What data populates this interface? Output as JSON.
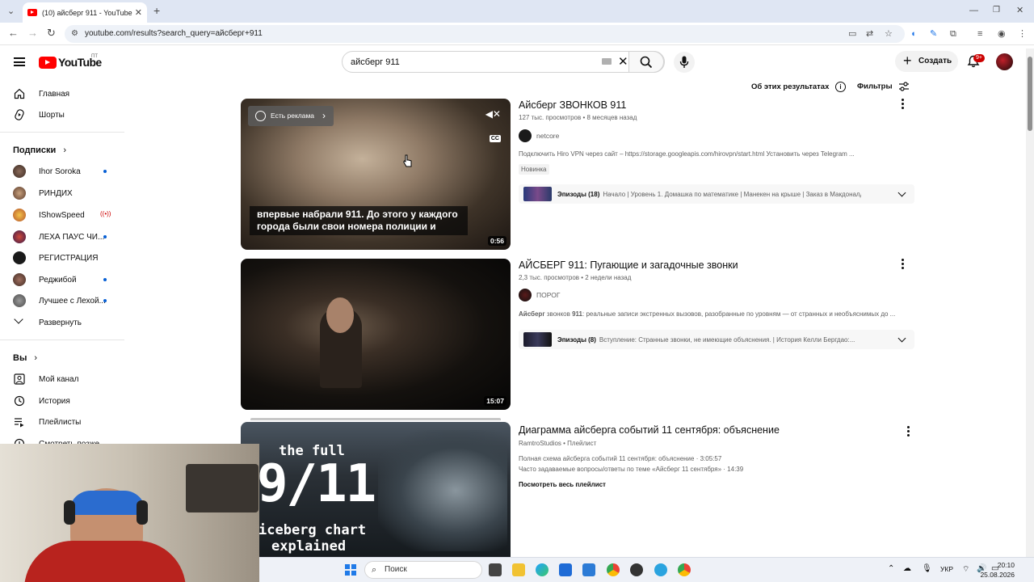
{
  "browser": {
    "tab_title": "(10) айсберг 911 - YouTube",
    "url": "youtube.com/results?search_query=айсберг+911"
  },
  "header": {
    "logo_text": "YouTube",
    "logo_country": "ПТ",
    "search_query": "айсберг 911",
    "create_label": "Создать",
    "notifications_badge": "9+"
  },
  "sidebar": {
    "main": [
      {
        "label": "Главная",
        "icon": "home-icon"
      },
      {
        "label": "Шорты",
        "icon": "shorts-icon"
      }
    ],
    "subscriptions_title": "Подписки",
    "subscriptions": [
      {
        "label": "Ihor Soroka",
        "indicator": "new"
      },
      {
        "label": "РИНДИХ",
        "indicator": ""
      },
      {
        "label": "IShowSpeed",
        "indicator": "live"
      },
      {
        "label": "ЛЕХА ПАУС ЧИ...",
        "indicator": "new"
      },
      {
        "label": "РЕГИСТРАЦИЯ",
        "indicator": ""
      },
      {
        "label": "Реджибой",
        "indicator": "new"
      },
      {
        "label": "Лучшее с Лехой...",
        "indicator": "new"
      }
    ],
    "expand_label": "Развернуть",
    "you_title": "Вы",
    "you_items": [
      {
        "label": "Мой канал",
        "icon": "my-channel-icon"
      },
      {
        "label": "История",
        "icon": "history-icon"
      },
      {
        "label": "Плейлисты",
        "icon": "playlists-icon"
      },
      {
        "label": "Смотреть позже",
        "icon": "watch-later-icon"
      }
    ]
  },
  "results_bar": {
    "about_label": "Об этих результатах",
    "filters_label": "Фильтры"
  },
  "results": [
    {
      "title": "Айсберг ЗВОНКОВ 911",
      "meta": "127 тыс. просмотров • 8 месяцев назад",
      "channel": "netcore",
      "description": "Подключить Hiro VPN через сайт – https://storage.googleapis.com/hirovpn/start.html Установить через Telegram ...",
      "badge": "Новинка",
      "episodes_label": "Эпизоды (18)",
      "episodes_text": "Начало | Уровень 1. Домашка по математике | Манекен на крыше | Заказ в Макдоналдс | ...",
      "duration": "0:56",
      "ad_label": "Есть реклама",
      "caption": "впервые набрали 911. До этого у каждого города были свои номера полиции и",
      "cc_label": "CC"
    },
    {
      "title": "АЙСБЕРГ 911: Пугающие и загадочные звонки",
      "meta": "2,3 тыс. просмотров • 2 недели назад",
      "channel": "ПОРОГ",
      "description_bold": "Айсберг",
      "description_mid": " звонков ",
      "description_bold2": "911",
      "description_rest": ": реальные записи экстренных вызовов, разобранные по уровням — от странных и необъяснимых до ...",
      "episodes_label": "Эпизоды (8)",
      "episodes_text": "Вступление: Странные звонки, не имеющие объяснения. | История Келли Бергдао:...",
      "duration": "15:07"
    },
    {
      "title": "Диаграмма айсберга событий 11 сентября: объяснение",
      "channel_line": "RamtroStudios • Плейлист",
      "line1": "Полная схема айсберга событий 11 сентября: объяснение · 3:05:57",
      "line2": "Часто задаваемые вопросы/ответы по теме «Айсберг 11 сентября» · 14:39",
      "view_all": "Посмотреть весь плейлист",
      "thumb_text_1": "the full",
      "thumb_text_2": "9/11",
      "thumb_text_3": "iceberg chart",
      "thumb_text_4": "explained"
    }
  ],
  "taskbar": {
    "search_placeholder": "Поиск",
    "language": "УКР",
    "time": "20:10",
    "date": "25.08.2026"
  },
  "colors": {
    "brand_red": "#ff0000",
    "link_blue": "#065fd4",
    "badge_red": "#cc0000"
  }
}
